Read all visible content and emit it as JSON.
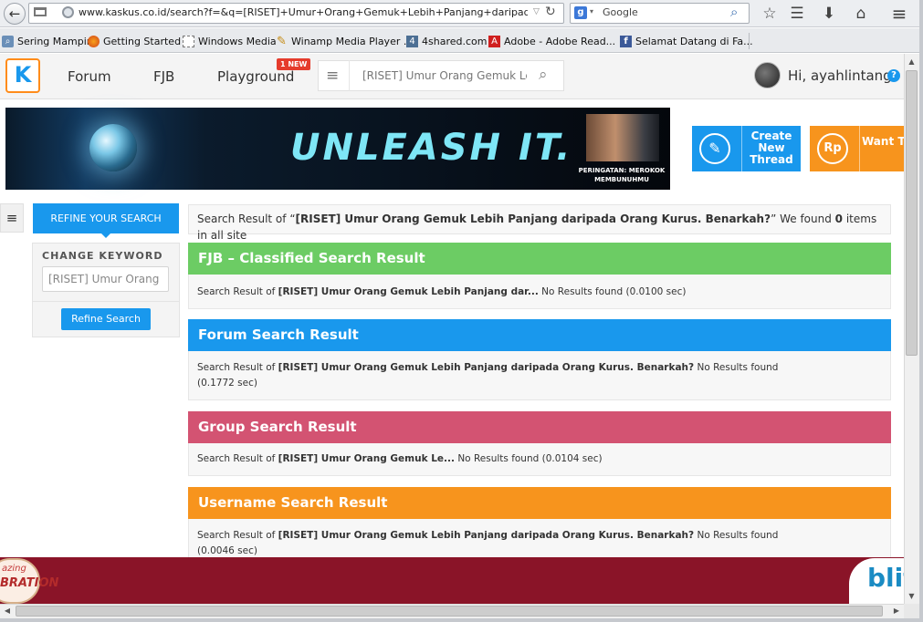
{
  "browser": {
    "url": "www.kaskus.co.id/search?f=&q=[RISET]+Umur+Orang+Gemuk+Lebih+Panjang+daripada+Orang+K",
    "search_engine": "Google",
    "bookmarks": [
      {
        "label": "Sering Mampir",
        "icon": "frequent-icon"
      },
      {
        "label": "Getting Started",
        "icon": "firefox-icon"
      },
      {
        "label": "Windows Media",
        "icon": "blank-page-icon"
      },
      {
        "label": "Winamp Media Player ...",
        "icon": "winamp-icon"
      },
      {
        "label": "4shared.com",
        "icon": "4shared-icon"
      },
      {
        "label": "Adobe - Adobe Read...",
        "icon": "adobe-icon"
      },
      {
        "label": "Selamat Datang di Fa...",
        "icon": "facebook-icon"
      }
    ]
  },
  "header": {
    "logo": "K",
    "nav": {
      "forum": "Forum",
      "fjb": "FJB",
      "playground": "Playground"
    },
    "new_badge": "1 NEW",
    "search_value": "[RISET] Umur Orang Gemuk Leb",
    "greeting": "Hi, ayahlintang",
    "help": "?"
  },
  "banner": {
    "headline": "UNLEASH IT.",
    "warning": "PERINGATAN: MEROKOK MEMBUNUHMU"
  },
  "actions": {
    "create_thread": "Create New Thread",
    "sell_icon": "Rp",
    "sell": "Want To Sell"
  },
  "sidebar": {
    "toggle": "≡",
    "refine_tab": "REFINE YOUR SEARCH",
    "change_keyword_label": "CHANGE KEYWORD",
    "keyword_value": "[RISET] Umur Orang Gemuk Lebih Panjang daripada Orang Kurus. Benarkah?",
    "refine_button": "Refine Search"
  },
  "results": {
    "summary": {
      "prefix": "Search Result of “",
      "query": "[RISET] Umur Orang Gemuk Lebih Panjang daripada Orang Kurus. Benarkah?",
      "middle": "” We found ",
      "count": "0",
      "suffix": " items in all site"
    },
    "sections": {
      "fjb": {
        "title": "FJB – Classified Search Result",
        "prefix": "Search Result of ",
        "query": "[RISET] Umur Orang Gemuk Lebih Panjang dar...",
        "status": " No Results found (0.0100 sec)"
      },
      "forum": {
        "title": "Forum Search Result",
        "prefix": "Search Result of ",
        "query": "[RISET] Umur Orang Gemuk Lebih Panjang daripada Orang Kurus. Benarkah?",
        "status": " No Results found (0.1772 sec)"
      },
      "group": {
        "title": "Group Search Result",
        "prefix": "Search Result of ",
        "query": "[RISET] Umur Orang Gemuk Le...",
        "status": " No Results found (0.0104 sec)"
      },
      "username": {
        "title": "Username Search Result",
        "prefix": "Search Result of ",
        "query": "[RISET] Umur Orang Gemuk Lebih Panjang daripada Orang Kurus. Benarkah?",
        "status": " No Results found (0.0046 sec)"
      }
    }
  },
  "bottom_ad": {
    "small": "azing",
    "big": "BRATION",
    "brand": "blit"
  },
  "colors": {
    "fjb": "#6ccc64",
    "forum": "#1998ed",
    "group": "#d35372",
    "username": "#f7941d",
    "ad": "#8a1428"
  }
}
